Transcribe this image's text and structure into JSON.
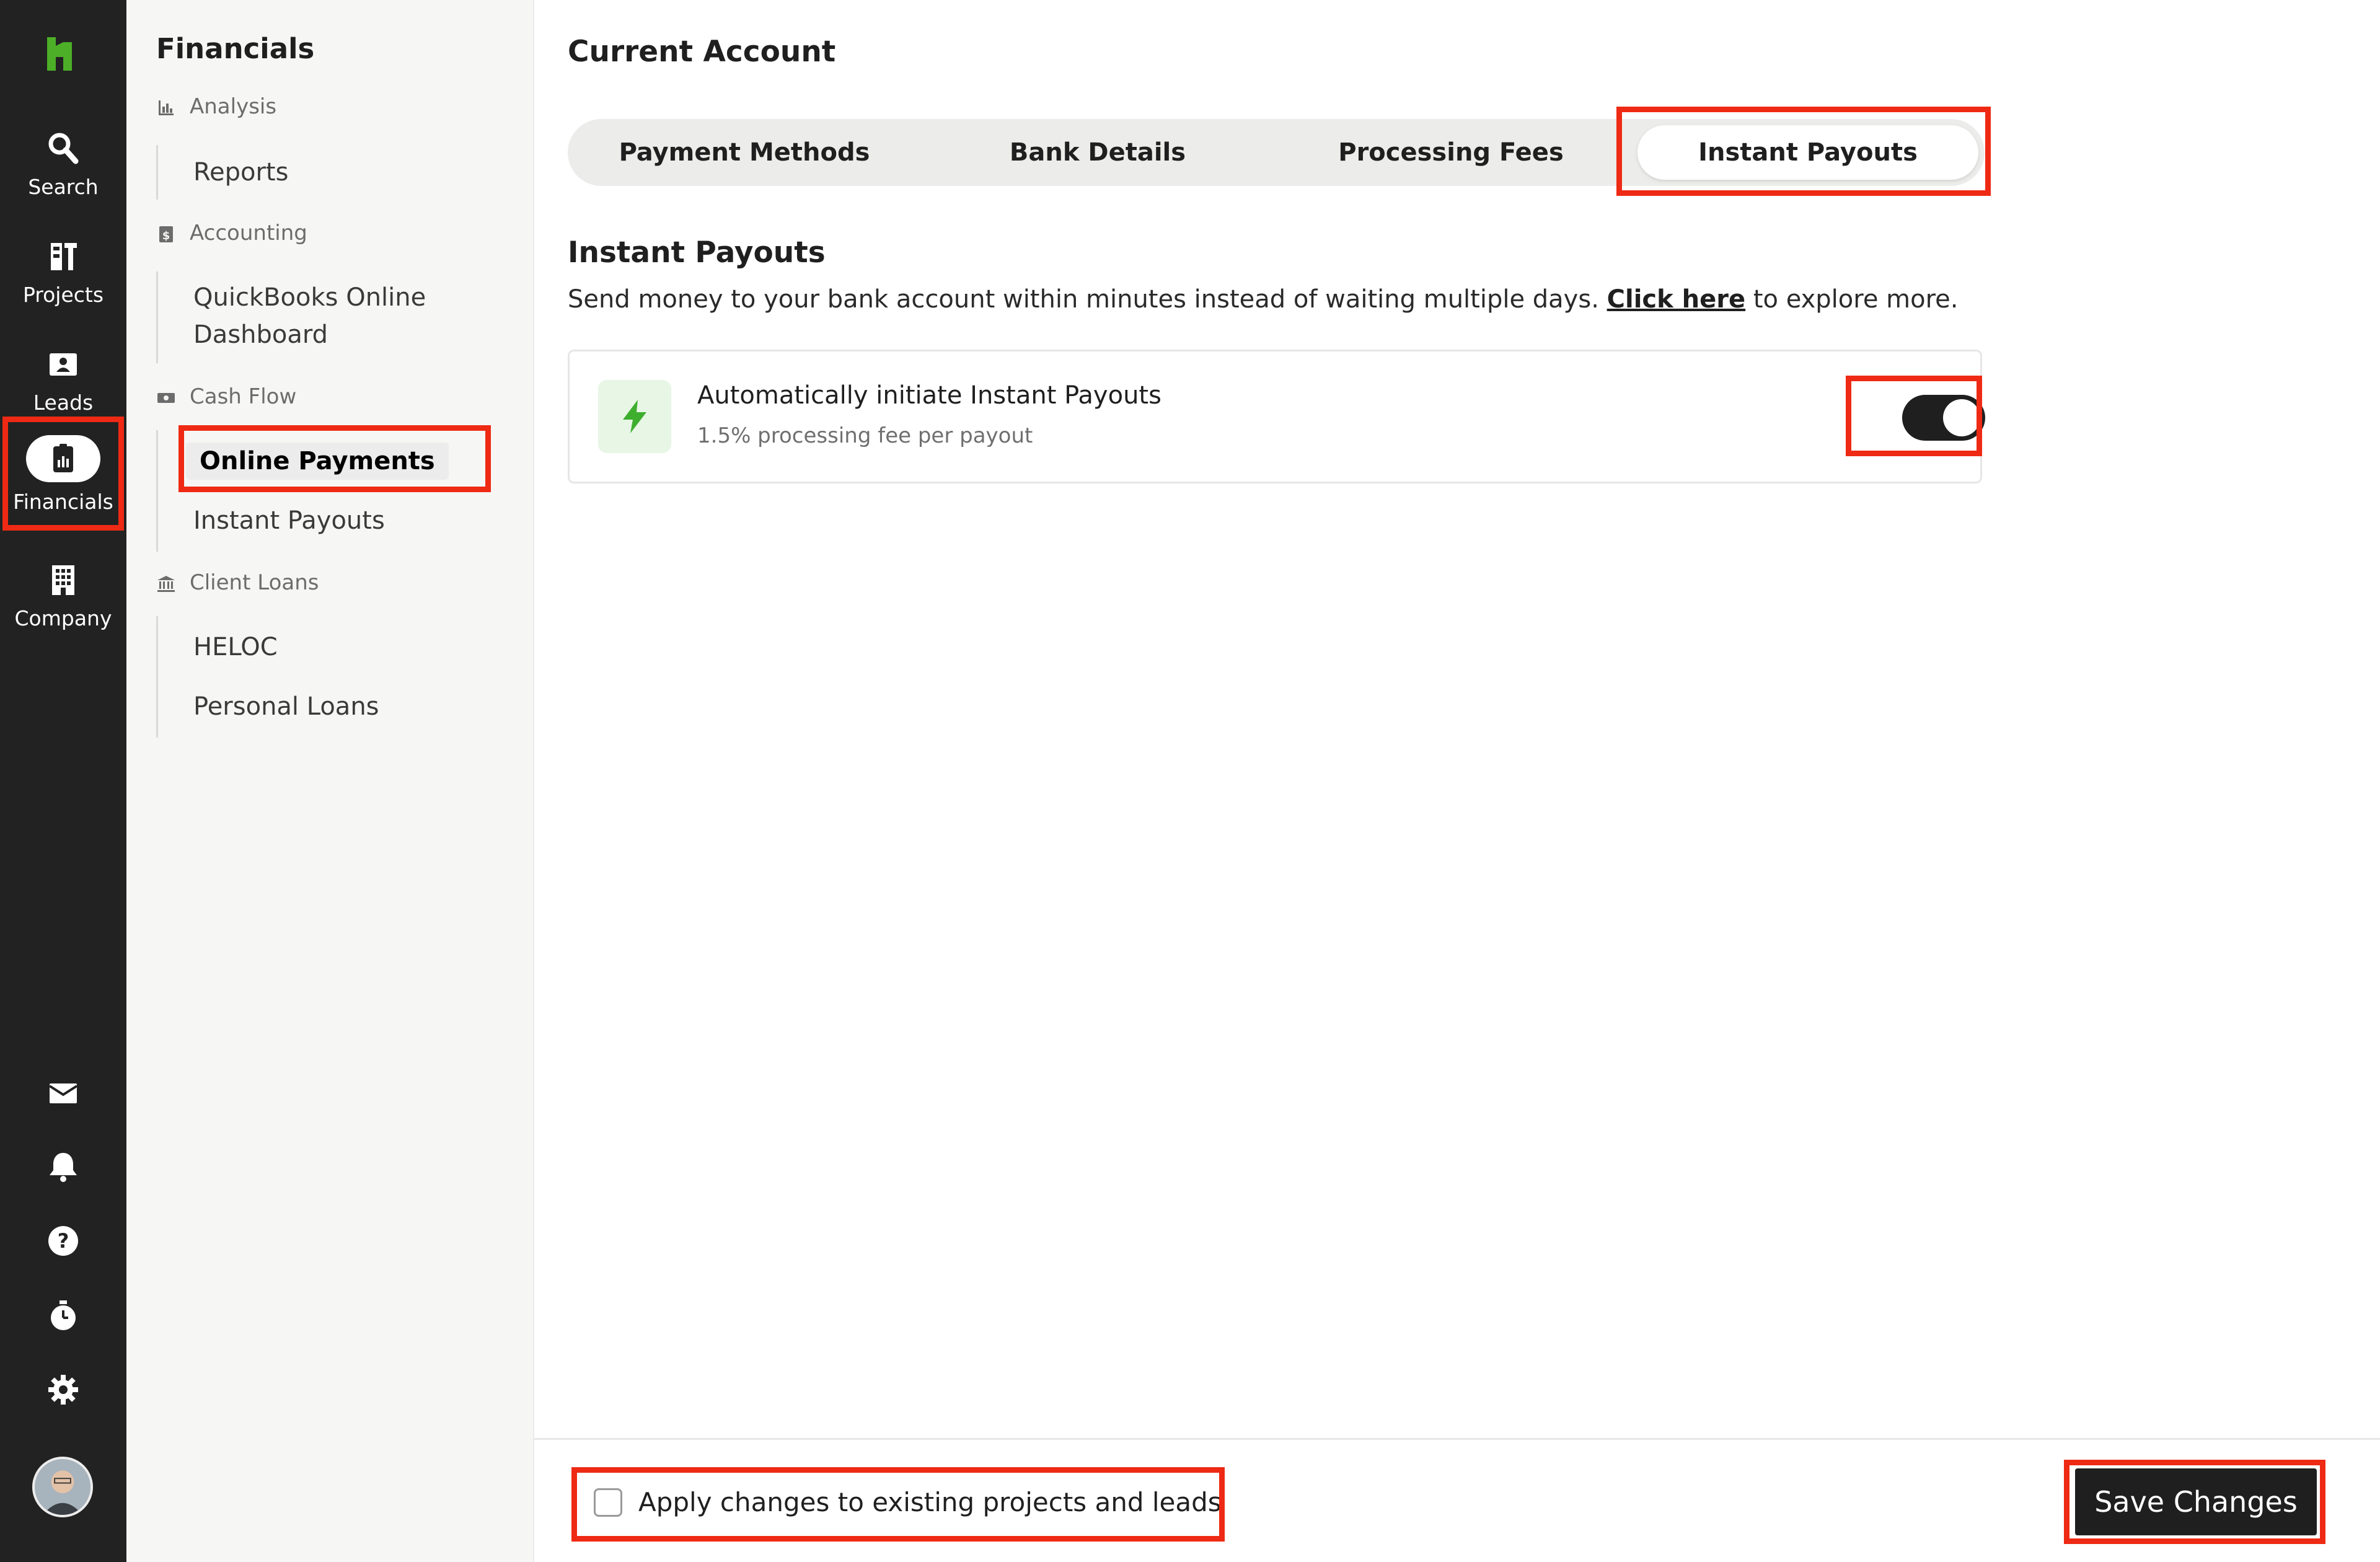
{
  "rail": {
    "items": [
      {
        "label": "Search",
        "icon": "search-icon"
      },
      {
        "label": "Projects",
        "icon": "projects-icon"
      },
      {
        "label": "Leads",
        "icon": "leads-icon"
      },
      {
        "label": "Financials",
        "icon": "financials-icon",
        "active": true
      },
      {
        "label": "Company",
        "icon": "company-icon"
      }
    ],
    "bottom_icons": [
      "inbox-icon",
      "bell-icon",
      "help-icon",
      "timer-icon",
      "gear-icon"
    ],
    "brand_color": "#4caf27",
    "highlight_color": "#ee2a14"
  },
  "sidebar": {
    "title": "Financials",
    "groups": [
      {
        "label": "Analysis",
        "icon": "bar-chart-icon",
        "links": [
          "Reports"
        ]
      },
      {
        "label": "Accounting",
        "icon": "dollar-doc-icon",
        "links": [
          "QuickBooks Online Dashboard"
        ]
      },
      {
        "label": "Cash Flow",
        "icon": "cash-icon",
        "links": [
          "Online Payments",
          "Instant Payouts"
        ]
      },
      {
        "label": "Client Loans",
        "icon": "bank-icon",
        "links": [
          "HELOC",
          "Personal Loans"
        ]
      }
    ],
    "qb_line1": "QuickBooks Online",
    "qb_line2": "Dashboard",
    "active_link": "Online Payments"
  },
  "main": {
    "title": "Current Account",
    "tabs": [
      "Payment Methods",
      "Bank Details",
      "Processing Fees",
      "Instant Payouts"
    ],
    "selected_tab": "Instant Payouts",
    "section_title": "Instant Payouts",
    "description_before": "Send money to your bank account within minutes instead of waiting multiple days. ",
    "description_link": "Click here",
    "description_after": " to explore more.",
    "card": {
      "title": "Automatically initiate Instant Payouts",
      "subtitle": "1.5% processing fee per payout",
      "toggle_on": true
    }
  },
  "footer": {
    "apply_label": "Apply changes to existing projects and leads",
    "apply_checked": false,
    "save_label": "Save Changes"
  }
}
